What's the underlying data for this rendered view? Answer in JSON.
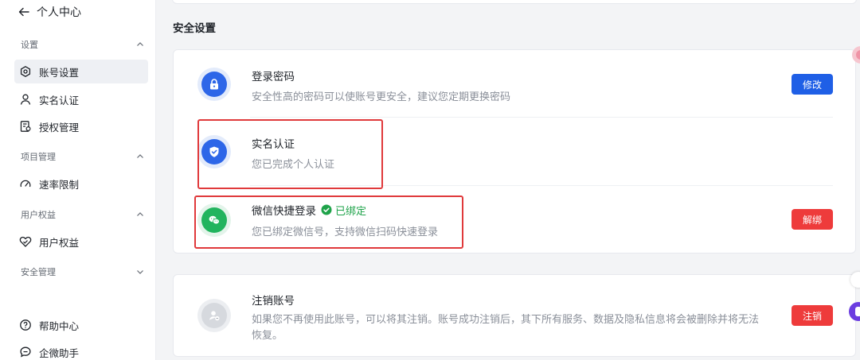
{
  "sidebar": {
    "back_label": "个人中心",
    "groups": [
      {
        "label": "设置",
        "expanded": true
      },
      {
        "label": "项目管理",
        "expanded": true
      },
      {
        "label": "用户权益",
        "expanded": true
      },
      {
        "label": "安全管理",
        "expanded": false
      }
    ],
    "items": [
      {
        "label": "账号设置",
        "icon": "settings-icon",
        "active": true
      },
      {
        "label": "实名认证",
        "icon": "user-icon",
        "active": false
      },
      {
        "label": "授权管理",
        "icon": "authorization-icon",
        "active": false
      },
      {
        "label": "速率限制",
        "icon": "speed-icon",
        "active": false
      },
      {
        "label": "用户权益",
        "icon": "benefit-icon",
        "active": false
      },
      {
        "label": "帮助中心",
        "icon": "help-icon",
        "active": false
      },
      {
        "label": "企微助手",
        "icon": "chat-assistant-icon",
        "active": false
      }
    ]
  },
  "main": {
    "section_title": "安全设置",
    "rows": [
      {
        "title": "登录密码",
        "description": "安全性高的密码可以使账号更安全，建议您定期更换密码",
        "icon": "lock-icon",
        "button_label": "修改"
      },
      {
        "title": "实名认证",
        "description": "您已完成个人认证",
        "icon": "shield-check-icon"
      },
      {
        "title": "微信快捷登录",
        "status": "已绑定",
        "description": "您已绑定微信号，支持微信扫码快速登录",
        "icon": "wechat-icon",
        "button_label": "解绑"
      }
    ],
    "cancel": {
      "title": "注销账号",
      "description_line1": "如果您不再使用此账号，可以将其注销。账号成功注销后，其下所有服务、数据及隐私信息将会被删除并将无法",
      "description_line2": "恢复。",
      "icon": "user-remove-icon",
      "button_label": "注销"
    }
  },
  "colors": {
    "primary": "#1f5fe6",
    "danger": "#ee3b3b",
    "success": "#1fa34a",
    "highlight_box": "#e0393b"
  }
}
